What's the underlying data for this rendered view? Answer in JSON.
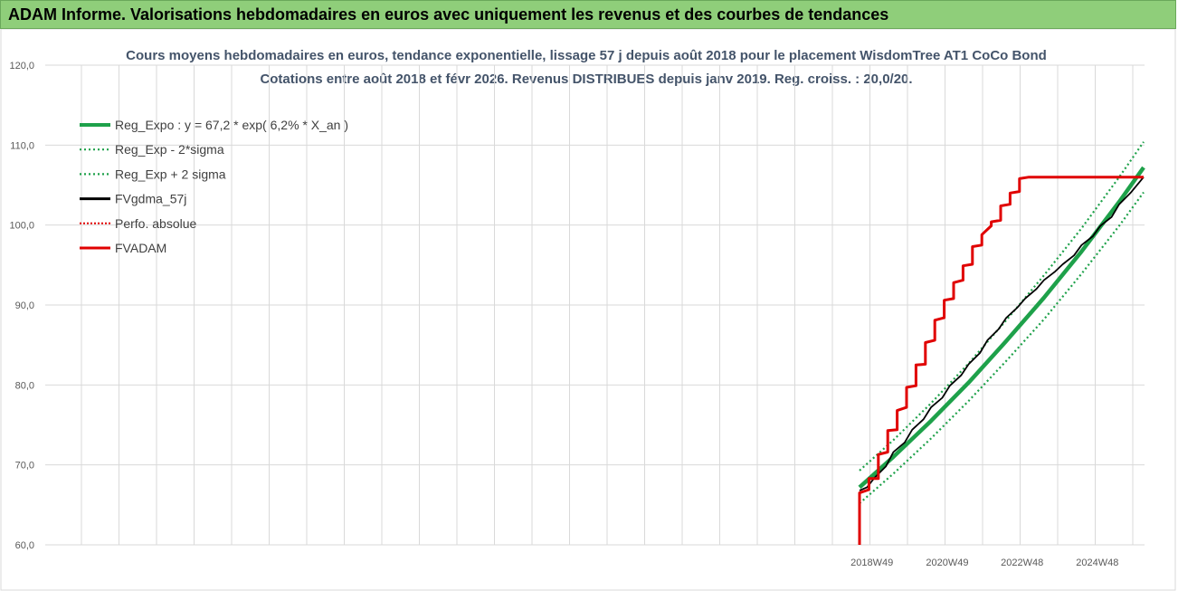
{
  "page": {
    "header_title": "ADAM Informe. Valorisations hebdomadaires en euros avec uniquement les revenus et des courbes de tendances"
  },
  "colors": {
    "header_bg": "#8fce7a",
    "reg_expo": "#1ea14a",
    "sigma": "#1ea14a",
    "fvgdma": "#000000",
    "perfo": "#e00000",
    "fvadam": "#e00000",
    "grid": "#d9d9d9"
  },
  "chart_data": {
    "type": "line",
    "title": "Cours moyens hebdomadaires en euros, tendance exponentielle, lissage 57 j depuis août 2018 pour le placement WisdomTree AT1 CoCo Bond",
    "subtitle": "Cotations entre août 2018 et févr 2026. Revenus DISTRIBUES depuis janv 2019. Reg. croiss. : 20,0/20.",
    "ylim": [
      60,
      120
    ],
    "yticks": [
      "60,0",
      "70,0",
      "80,0",
      "90,0",
      "100,0",
      "110,0",
      "120,0"
    ],
    "xticks": [
      "2018W49",
      "2020W49",
      "2022W48",
      "2024W48"
    ],
    "grid": true,
    "legend_position": "top-left",
    "x_range_years": [
      2018.6,
      2026.15
    ],
    "series": [
      {
        "name": "Reg_Expo : y = 67,2 * exp( 6,2% *  X_an )",
        "style": "solid-thick",
        "x": [
          2018.6,
          2019.5,
          2020.5,
          2021.5,
          2022.5,
          2023.5,
          2024.5,
          2025.5,
          2026.15
        ],
        "values": [
          67.2,
          71.0,
          75.5,
          80.3,
          85.5,
          90.9,
          96.7,
          102.9,
          107.2
        ]
      },
      {
        "name": "Reg_Exp - 2*sigma",
        "style": "dotted",
        "x": [
          2018.6,
          2019.5,
          2020.5,
          2021.5,
          2022.5,
          2023.5,
          2024.5,
          2025.5,
          2026.15
        ],
        "values": [
          65.2,
          68.9,
          73.3,
          78.0,
          83.0,
          88.2,
          93.9,
          99.9,
          104.1
        ]
      },
      {
        "name": "Reg_Exp + 2 sigma",
        "style": "dotted",
        "x": [
          2018.6,
          2019.5,
          2020.5,
          2021.5,
          2022.5,
          2023.5,
          2024.5,
          2025.5,
          2026.15
        ],
        "values": [
          69.3,
          73.1,
          77.7,
          82.7,
          88.1,
          93.7,
          99.6,
          106.0,
          110.4
        ]
      },
      {
        "name": "FVgdma_57j",
        "style": "solid",
        "x": [
          2018.6,
          2018.8,
          2019.0,
          2019.3,
          2019.5,
          2019.8,
          2020.0,
          2020.3,
          2020.5,
          2020.8,
          2021.0,
          2021.3,
          2021.5,
          2021.8,
          2022.0,
          2022.3,
          2022.5,
          2022.8,
          2023.0,
          2023.3,
          2023.5,
          2023.8,
          2024.0,
          2024.3,
          2024.5,
          2024.8,
          2025.0,
          2025.3,
          2025.5,
          2025.8,
          2026.15
        ],
        "values": [
          66.8,
          67.2,
          68.4,
          69.8,
          71.6,
          72.8,
          74.4,
          75.7,
          77.2,
          78.4,
          79.9,
          81.2,
          82.6,
          84.0,
          85.6,
          87.0,
          88.4,
          89.7,
          90.8,
          92.0,
          93.1,
          94.2,
          95.1,
          96.2,
          97.5,
          98.6,
          99.9,
          101.0,
          102.6,
          104.0,
          106.0
        ]
      },
      {
        "name": "Perfo. absolue",
        "style": "dotted",
        "x": [],
        "values": []
      },
      {
        "name": "FVADAM",
        "style": "step-thick",
        "x": [
          2018.6,
          2018.6,
          2018.85,
          2018.85,
          2019.1,
          2019.1,
          2019.35,
          2019.35,
          2019.6,
          2019.6,
          2019.85,
          2019.85,
          2020.1,
          2020.1,
          2020.35,
          2020.35,
          2020.6,
          2020.6,
          2020.85,
          2020.85,
          2021.1,
          2021.1,
          2021.35,
          2021.35,
          2021.6,
          2021.6,
          2021.85,
          2021.85,
          2022.1,
          2022.1,
          2022.35,
          2022.35,
          2022.6,
          2022.6,
          2022.85,
          2022.85,
          2023.1,
          2023.1,
          2023.35,
          2023.35,
          2023.6,
          2023.6,
          2023.85,
          2023.85,
          2024.1,
          2024.1,
          2024.35,
          2024.35,
          2024.6,
          2024.6,
          2024.85,
          2024.85,
          2025.1,
          2025.1,
          2025.35,
          2025.35,
          2025.6,
          2025.6,
          2025.85,
          2025.85,
          2026.0,
          2026.0,
          2026.15
        ],
        "values": [
          60.0,
          66.5,
          66.9,
          68.3,
          68.3,
          71.3,
          71.6,
          74.3,
          74.4,
          76.8,
          77.2,
          79.7,
          79.9,
          82.5,
          82.6,
          85.3,
          85.6,
          88.1,
          88.4,
          90.6,
          90.8,
          92.8,
          93.1,
          94.9,
          95.1,
          97.3,
          97.5,
          98.8,
          99.9,
          100.4,
          100.6,
          102.4,
          102.6,
          104.0,
          104.2,
          105.8,
          106.0,
          106.0,
          106.0,
          106.0,
          106.0,
          106.0,
          106.0,
          106.0,
          106.0,
          106.0,
          106.0,
          106.0,
          106.0,
          106.0,
          106.0,
          106.0,
          106.0,
          106.0,
          106.0,
          106.0,
          106.0,
          106.0,
          106.0,
          106.0,
          106.0,
          106.0,
          106.0
        ]
      }
    ]
  }
}
